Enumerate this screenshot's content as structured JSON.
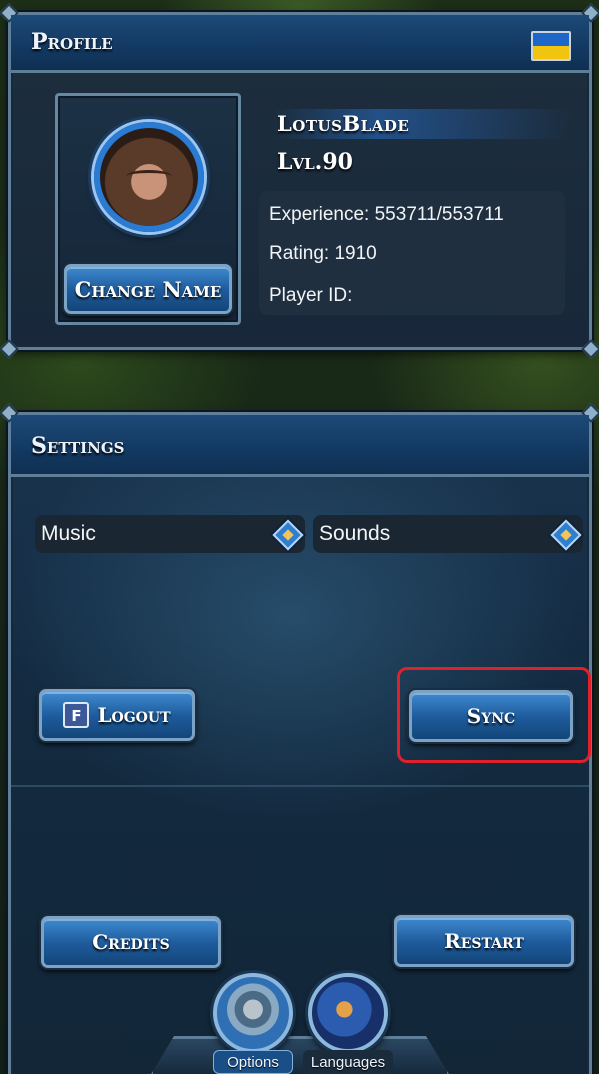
{
  "profile": {
    "title": "Profile",
    "change_name_label": "Change Name",
    "player_name": "LotusBlade",
    "level": "Lvl.90",
    "experience": "Experience: 553711/553711",
    "rating": "Rating: 1910",
    "player_id": "Player ID:",
    "flag_icon": "ukraine-flag-icon",
    "colors": {
      "flag_blue": "#1e66c8",
      "flag_yellow": "#f1c40f"
    }
  },
  "settings": {
    "title": "Settings",
    "music_label": "Music",
    "sounds_label": "Sounds",
    "logout_label": "Logout",
    "sync_label": "Sync",
    "credits_label": "Credits",
    "restart_label": "Restart",
    "facebook_icon": "facebook-icon",
    "highlight_color": "#e0202a"
  },
  "nav": {
    "options_label": "Options",
    "languages_label": "Languages",
    "options_icon": "gear-icon",
    "languages_icon": "globe-icon"
  }
}
